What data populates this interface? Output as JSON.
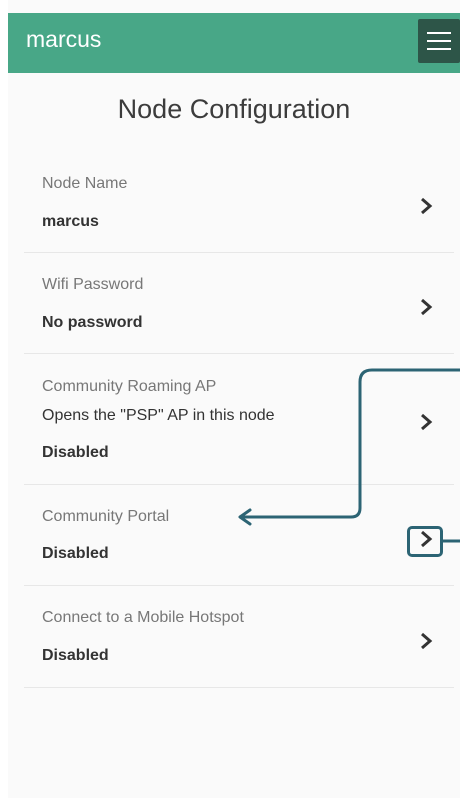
{
  "appbar": {
    "title": "marcus",
    "menu_icon": "hamburger-menu-icon",
    "color": "#48a787"
  },
  "page": {
    "title": "Node Configuration"
  },
  "settings": [
    {
      "label": "Node Name",
      "value": "marcus"
    },
    {
      "label": "Wifi Password",
      "value": "No password"
    },
    {
      "label": "Community Roaming AP",
      "description": "Opens the \"PSP\" AP in this node",
      "value": "Disabled"
    },
    {
      "label": "Community Portal",
      "value": "Disabled"
    },
    {
      "label": "Connect to a Mobile Hotspot",
      "value": "Disabled"
    }
  ],
  "icons": {
    "row_action": "chevron-right-icon"
  },
  "annotation": {
    "color": "#2c6474",
    "highlighted_row": "Community Portal"
  }
}
